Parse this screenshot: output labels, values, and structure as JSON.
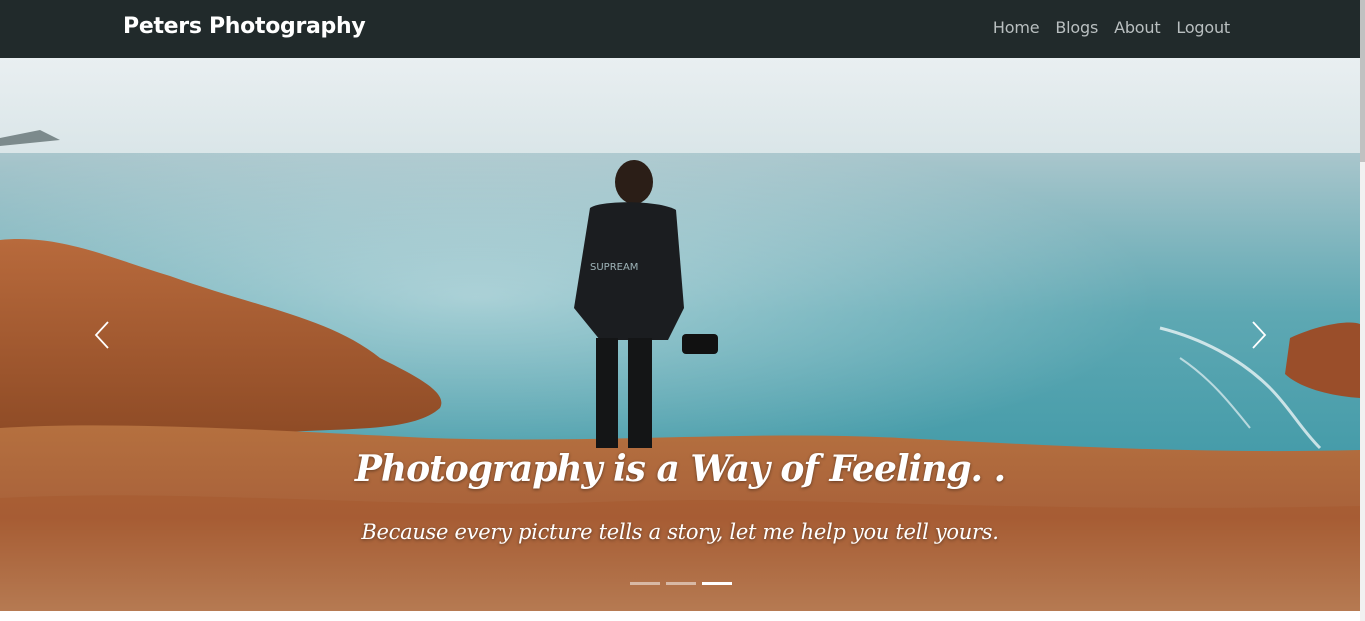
{
  "navbar": {
    "brand": "Peters Photography",
    "links": [
      "Home",
      "Blogs",
      "About",
      "Logout"
    ]
  },
  "carousel": {
    "caption_title": "Photography is a Way of Feeling. .",
    "caption_subtitle": "Because every picture tells a story, let me help you tell yours.",
    "jacket_text": "SUPREAM",
    "indicator_count": 3,
    "active_indicator": 3,
    "prev_icon": "chevron-left-icon",
    "next_icon": "chevron-right-icon"
  },
  "colors": {
    "navbar_bg": "#212a2b",
    "brand_text": "#ffffff",
    "nav_link": "#b9bfc0",
    "sea": "#3b9ba8",
    "hillside": "#b0653a"
  }
}
